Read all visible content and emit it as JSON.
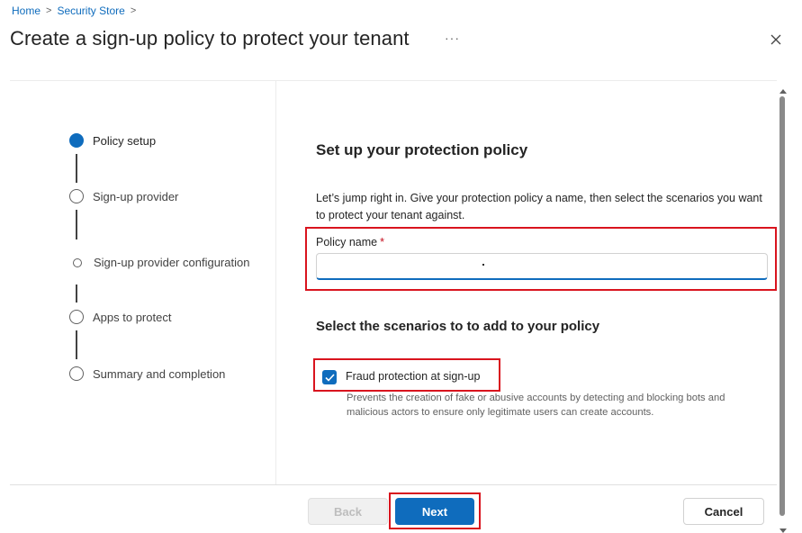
{
  "breadcrumb": {
    "items": [
      "Home",
      "Security Store"
    ],
    "separator": ">"
  },
  "header": {
    "title": "Create a sign-up policy to protect your tenant",
    "more_glyph": "···"
  },
  "steps": [
    {
      "label": "Policy setup",
      "state": "active"
    },
    {
      "label": "Sign-up provider",
      "state": "pending"
    },
    {
      "label": "Sign-up provider configuration",
      "state": "substep"
    },
    {
      "label": "Apps to protect",
      "state": "pending"
    },
    {
      "label": "Summary and completion",
      "state": "pending"
    }
  ],
  "main": {
    "section_title": "Set up your protection policy",
    "intro": "Let’s jump right in. Give your protection policy a name, then select the scenarios you want to protect your tenant against.",
    "policy_name": {
      "label": "Policy name",
      "required_mark": "*",
      "value": "",
      "placeholder": ""
    },
    "scenarios_title": "Select the scenarios to to add to your policy",
    "scenario": {
      "label": "Fraud protection at sign-up",
      "checked": true,
      "description": "Prevents the creation of fake or abusive accounts by detecting and blocking bots and malicious actors to ensure only legitimate users can create accounts."
    }
  },
  "footer": {
    "back_label": "Back",
    "next_label": "Next",
    "cancel_label": "Cancel"
  },
  "colors": {
    "accent": "#0f6cbd",
    "highlight": "#d9141e",
    "required": "#c50f1f"
  }
}
